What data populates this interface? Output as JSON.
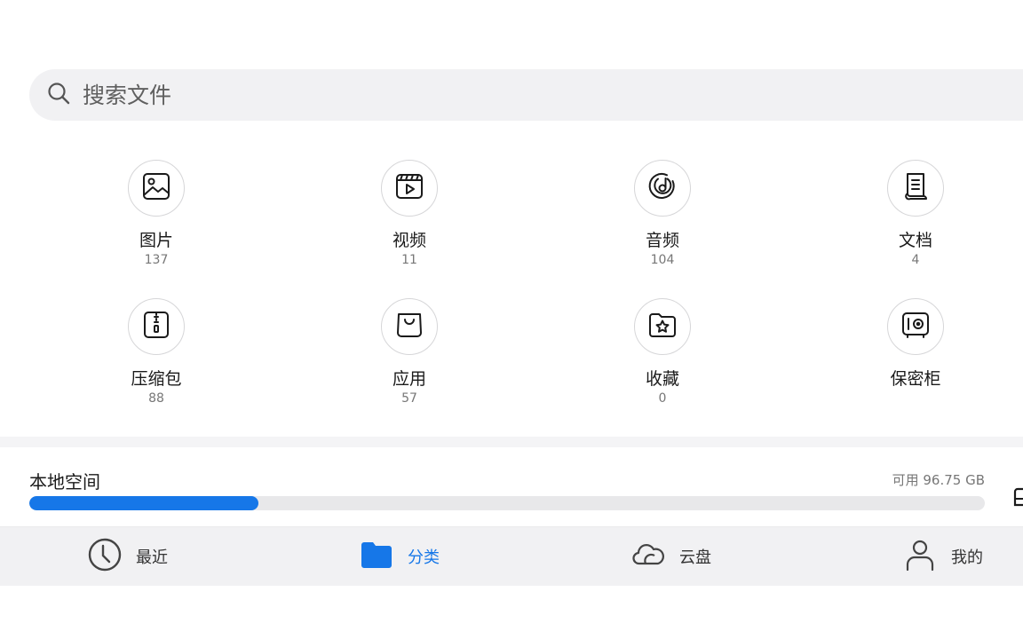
{
  "search": {
    "placeholder": "搜索文件"
  },
  "categories": [
    {
      "label": "图片",
      "count": "137",
      "icon": "image-icon"
    },
    {
      "label": "视频",
      "count": "11",
      "icon": "video-icon"
    },
    {
      "label": "音频",
      "count": "104",
      "icon": "music-disc-icon"
    },
    {
      "label": "文档",
      "count": "4",
      "icon": "document-icon"
    },
    {
      "label": "压缩包",
      "count": "88",
      "icon": "zip-archive-icon"
    },
    {
      "label": "应用",
      "count": "57",
      "icon": "shopping-bag-icon"
    },
    {
      "label": "收藏",
      "count": "0",
      "icon": "star-folder-icon"
    },
    {
      "label": "保密柜",
      "count": "",
      "icon": "safe-icon"
    }
  ],
  "storage": {
    "title": "本地空间",
    "free": "可用 96.75 GB",
    "used_fraction": 0.24
  },
  "nav": [
    {
      "label": "最近",
      "icon": "clock-icon",
      "active": false
    },
    {
      "label": "分类",
      "icon": "folder-icon",
      "active": true
    },
    {
      "label": "云盘",
      "icon": "cloud-icon",
      "active": false
    },
    {
      "label": "我的",
      "icon": "person-icon",
      "active": false
    }
  ],
  "colors": {
    "accent": "#1677e8",
    "background": "#ffffff",
    "search_bg": "#f1f1f3",
    "nav_bg": "#f1f1f3"
  }
}
